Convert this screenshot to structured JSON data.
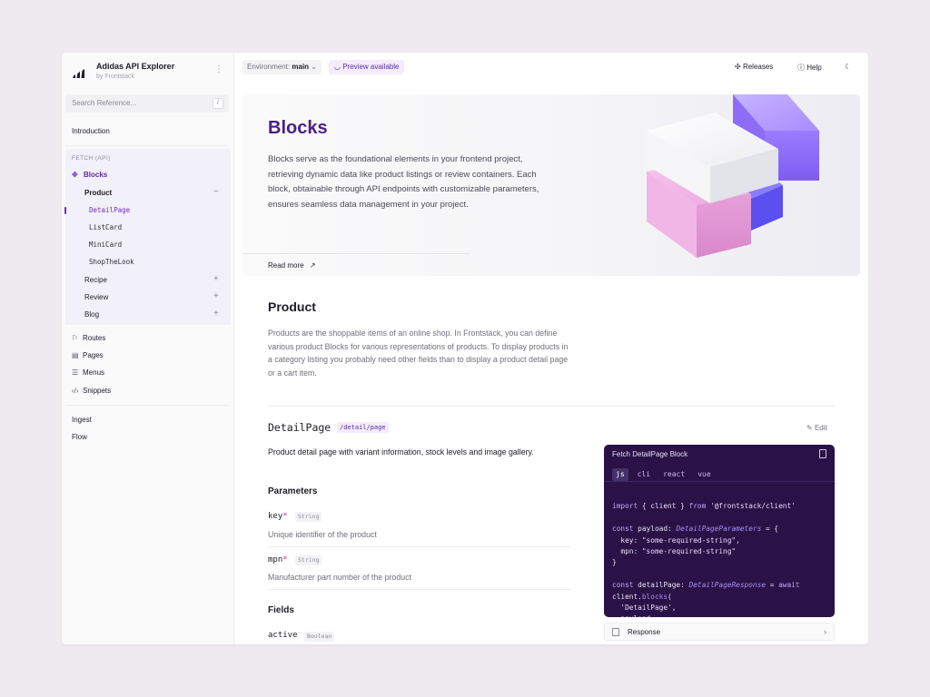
{
  "app": {
    "title": "Adidas API Explorer",
    "subtitle": "by Frontstack",
    "more_icon": "⋮"
  },
  "sidebar": {
    "search_placeholder": "Search Reference...",
    "search_shortcut": "/",
    "introduction": "Introduction",
    "group_label": "FETCH (API)",
    "blocks_label": "Blocks",
    "product_label": "Product",
    "product_toggle": "−",
    "leaves": [
      "DetailPage",
      "ListCard",
      "MiniCard",
      "ShopTheLook"
    ],
    "collapsed": [
      {
        "label": "Recipe",
        "toggle": "+"
      },
      {
        "label": "Review",
        "toggle": "+"
      },
      {
        "label": "Blog",
        "toggle": "+"
      }
    ],
    "icon_items": [
      {
        "label": "Routes",
        "icon": "signpost-icon"
      },
      {
        "label": "Pages",
        "icon": "pages-icon"
      },
      {
        "label": "Menus",
        "icon": "menu-icon"
      },
      {
        "label": "Snippets",
        "icon": "code-icon"
      }
    ],
    "bottom_items": [
      "Ingest",
      "Flow"
    ]
  },
  "topbar": {
    "env_label": "Environment:",
    "env_value": "main",
    "preview_label": "Preview available",
    "releases_label": "Releases",
    "help_label": "Help"
  },
  "hero": {
    "title": "Blocks",
    "description": "Blocks serve as the foundational elements in your frontend project, retrieving dynamic data like product listings or review containers. Each block, obtainable through API endpoints with customizable parameters, ensures seamless data management in your project.",
    "read_more": "Read more"
  },
  "section": {
    "title": "Product",
    "description": "Products are the shoppable items of an online shop. In Frontstack, you can define various product Blocks for various representations of products. To display products in a category listing you probably need other fields than to display a product detail page or a cart item."
  },
  "detail": {
    "title": "DetailPage",
    "path": "/detail/page",
    "edit_label": "Edit",
    "description": "Product detail page with variant information, stock levels and image gallery.",
    "parameters_heading": "Parameters",
    "parameters": [
      {
        "name": "key",
        "required": "*",
        "type": "String",
        "description": "Unique identifier of the product"
      },
      {
        "name": "mpn",
        "required": "*",
        "type": "String",
        "description": "Manufacturer part number of the product"
      }
    ],
    "fields_heading": "Fields",
    "fields": [
      {
        "name": "active",
        "type": "Boolean"
      }
    ]
  },
  "code": {
    "title": "Fetch DetailPage Block",
    "tabs": [
      "js",
      "cli",
      "react",
      "vue"
    ],
    "active_tab": "js",
    "response_label": "Response",
    "colors": {
      "keyword": "#c9a6ff",
      "type": "#a98ef5",
      "string": "#f0d8ff",
      "plain": "#eae4f6"
    }
  },
  "colors": {
    "accent": "#5b2d9e",
    "accent_light": "#f3ecfd",
    "code_bg": "#2a1247"
  }
}
